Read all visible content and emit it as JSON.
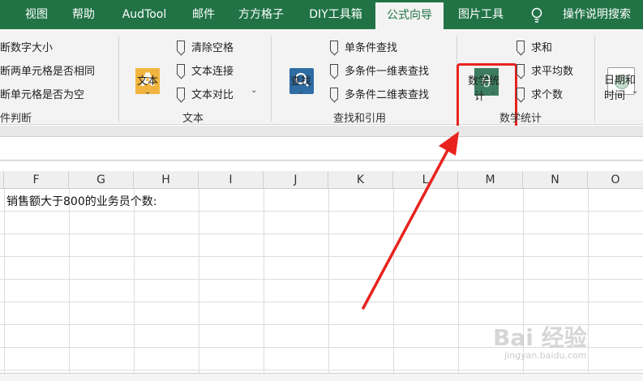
{
  "tabs": [
    "视图",
    "帮助",
    "AudTool",
    "邮件",
    "方方格子",
    "DIY工具箱",
    "公式向导",
    "图片工具"
  ],
  "active_tab": "公式向导",
  "help_search": "操作说明搜索",
  "ribbon": {
    "left_items": [
      "断数字大小",
      "断两单元格是否相同",
      "断单元格是否为空"
    ],
    "left_group_label": "件判断",
    "text_group": {
      "big_button": "文本",
      "items": [
        "清除空格",
        "文本连接",
        "文本对比"
      ],
      "label": "文本"
    },
    "lookup_group": {
      "big_button": "查找",
      "items": [
        "单条件查找",
        "多条件一维表查找",
        "多条件二维表查找"
      ],
      "label": "查找和引用"
    },
    "stats_group": {
      "big_button_line1": "数学统",
      "big_button_line2": "计",
      "items": [
        "求和",
        "求平均数",
        "求个数"
      ],
      "label": "数学统计"
    },
    "date_group": {
      "big_button_line1": "日期和",
      "big_button_line2": "时间"
    }
  },
  "columns": [
    "F",
    "G",
    "H",
    "I",
    "J",
    "K",
    "L",
    "M",
    "N",
    "O"
  ],
  "cell_text": "销售额大于800的业务员个数:",
  "watermark": "Bai 经验",
  "watermark_url": "jingyan.baidu.com",
  "colors": {
    "ribbon_green": "#217346",
    "highlight_red": "#e8231f"
  }
}
